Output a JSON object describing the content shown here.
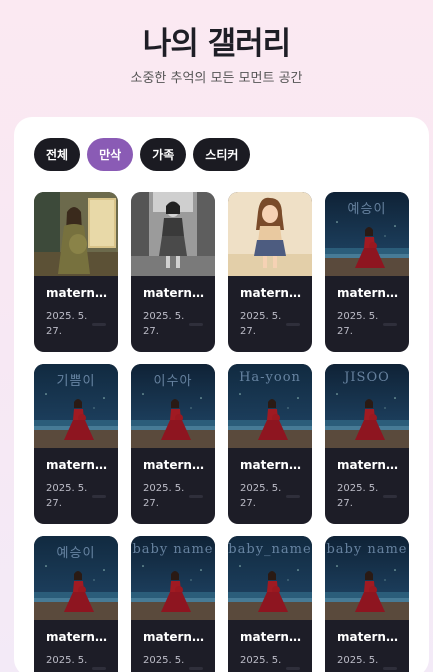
{
  "header": {
    "title": "나의 갤러리",
    "subtitle": "소중한 추억의 모든 모먼트 공간"
  },
  "tabs": [
    {
      "label": "전체",
      "active": false
    },
    {
      "label": "만삭",
      "active": true
    },
    {
      "label": "가족",
      "active": false
    },
    {
      "label": "스티커",
      "active": false
    }
  ],
  "cards": [
    {
      "title": "materni...",
      "date": "2025. 5. 27.",
      "scene": "painting-window",
      "overlay": ""
    },
    {
      "title": "materni...",
      "date": "2025. 5. 27.",
      "scene": "bw-street",
      "overlay": ""
    },
    {
      "title": "maternity",
      "date": "2025. 5. 27.",
      "scene": "cartoon",
      "overlay": ""
    },
    {
      "title": "maternity",
      "date": "2025. 5. 27.",
      "scene": "night-sea",
      "overlay": "예승이"
    },
    {
      "title": "maternity",
      "date": "2025. 5. 27.",
      "scene": "night-sea",
      "overlay": "기쁨이"
    },
    {
      "title": "maternity",
      "date": "2025. 5. 27.",
      "scene": "night-sea",
      "overlay": "이수아"
    },
    {
      "title": "maternity",
      "date": "2025. 5. 27.",
      "scene": "night-sea",
      "overlay": "Ha-yoon"
    },
    {
      "title": "maternity",
      "date": "2025. 5. 27.",
      "scene": "night-sea",
      "overlay": "JISOO"
    },
    {
      "title": "maternity",
      "date": "2025. 5.",
      "scene": "night-sea",
      "overlay": "예승이"
    },
    {
      "title": "maternity",
      "date": "2025. 5.",
      "scene": "night-sea",
      "overlay": "baby name"
    },
    {
      "title": "maternity",
      "date": "2025. 5.",
      "scene": "night-sea",
      "overlay": "baby_name"
    },
    {
      "title": "maternity",
      "date": "2025. 5.",
      "scene": "night-sea",
      "overlay": "baby name"
    }
  ],
  "colors": {
    "tab_active": "#8a5bb5",
    "tab": "#1b1b22",
    "card": "#1d1d27"
  }
}
